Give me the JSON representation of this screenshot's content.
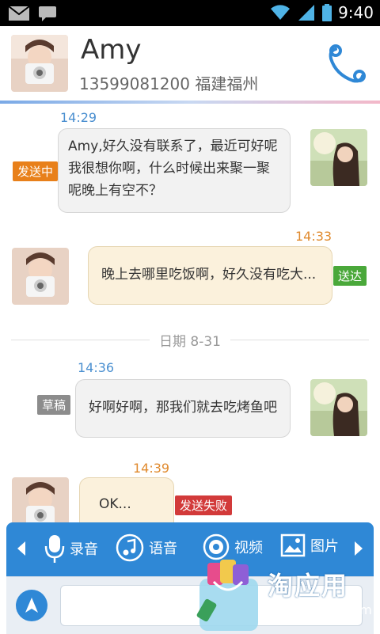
{
  "statusbar": {
    "time": "9:40"
  },
  "header": {
    "name": "Amy",
    "phone": "13599081200 福建福州"
  },
  "messages": [
    {
      "time": "14:29",
      "text": "Amy,好久没有联系了，最近可好呢我很想你啊，什么时候出来聚一聚呢晚上有空不？",
      "status": "发送中"
    },
    {
      "time": "14:33",
      "text": "晚上去哪里吃饭啊，好久没有吃大...",
      "status": "送达"
    },
    {
      "time": "14:36",
      "text": "好啊好啊，那我们就去吃烤鱼吧",
      "status": "草稿"
    },
    {
      "time": "14:39",
      "text": "OK...",
      "status": "发送失败"
    }
  ],
  "date_divider": "日期 8-31",
  "toolbar": {
    "record": "录音",
    "voice": "语音",
    "video": "视频",
    "image": "图片"
  },
  "watermark": {
    "text": "淘应用",
    "url": "app.taobao.com"
  },
  "colors": {
    "sending": "#e8801a",
    "delivered": "#4aa83a",
    "draft": "#8c8c8c",
    "failed": "#d23a3a",
    "accent": "#2f88d6"
  }
}
